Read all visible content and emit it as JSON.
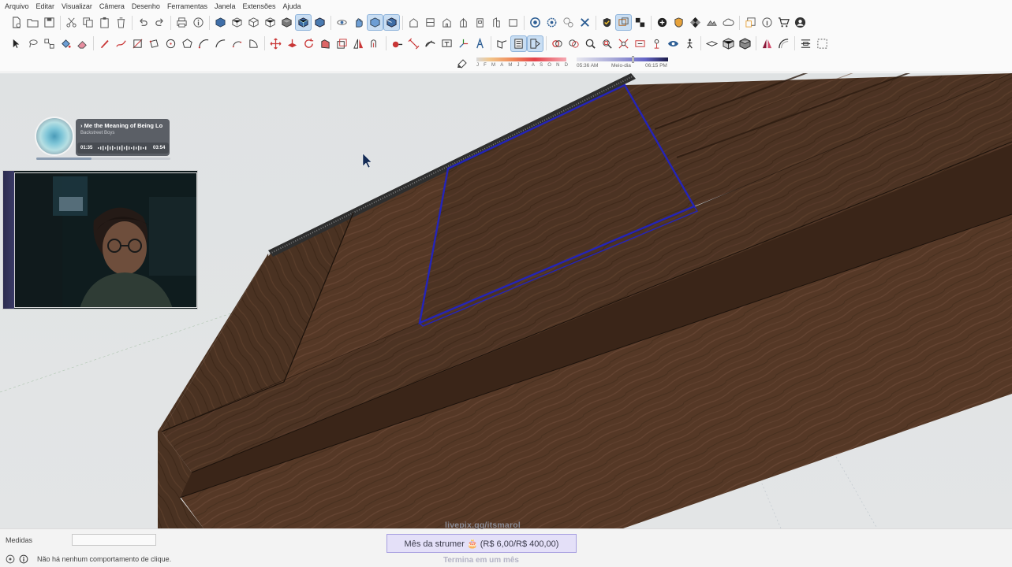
{
  "menubar": {
    "items": [
      "Arquivo",
      "Editar",
      "Visualizar",
      "Câmera",
      "Desenho",
      "Ferramentas",
      "Janela",
      "Extensões",
      "Ajuda"
    ]
  },
  "shadow_settings": {
    "months": [
      "J",
      "F",
      "M",
      "A",
      "M",
      "J",
      "J",
      "A",
      "S",
      "O",
      "N",
      "D"
    ],
    "time_start": "05:36 AM",
    "time_mid": "Meio-dia",
    "time_end": "06:15 PM"
  },
  "music_widget": {
    "title": "› Me the Meaning of Being Lo",
    "artist": "Backstreet Boys",
    "elapsed": "01:35",
    "total": "03:54",
    "progress": 0.41
  },
  "statusbar": {
    "measures_label": "Medidas",
    "measures_value": "",
    "status_text": "Não há nenhum comportamento de clique."
  },
  "stream_overlay": {
    "url": "livepix.gg/itsmarol",
    "goal_text": "Mês da strumer 🎂 (R$ 6,00/R$ 400,00)",
    "goal_end": "Termina em um mês"
  },
  "colors": {
    "selection": "#2424b8",
    "wood_dark": "#3f2a1d",
    "wood_mid": "#4d3424",
    "wood_light": "#5b3e2b",
    "background": "#e0e3e4"
  }
}
